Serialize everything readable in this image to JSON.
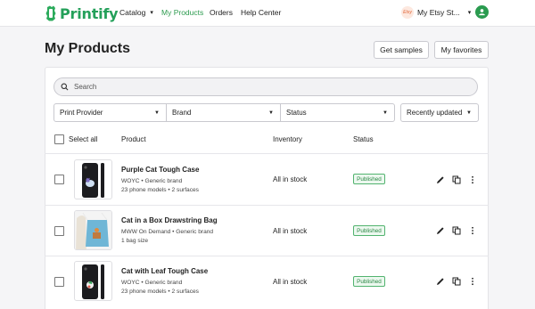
{
  "nav": {
    "logo_text": "Printify",
    "items": [
      {
        "label": "Catalog",
        "has_dropdown": true,
        "active": false
      },
      {
        "label": "My Products",
        "active": true
      },
      {
        "label": "Orders",
        "active": false
      },
      {
        "label": "Help Center",
        "active": false
      }
    ],
    "store": {
      "badge": "Etsy",
      "name": "My Etsy St..."
    },
    "accent_color": "#2a9b4f"
  },
  "page": {
    "title": "My Products",
    "buttons": {
      "samples": "Get samples",
      "favorites": "My favorites"
    }
  },
  "search": {
    "placeholder": "Search",
    "value": ""
  },
  "filters": {
    "print_provider": "Print Provider",
    "brand": "Brand",
    "status": "Status",
    "sort": "Recently updated"
  },
  "table": {
    "select_all": "Select all",
    "columns": {
      "product": "Product",
      "inventory": "Inventory",
      "status": "Status"
    },
    "rows": [
      {
        "name": "Purple Cat Tough Case",
        "meta1": "WOYC • Generic brand",
        "meta2": "23 phone models • 2 surfaces",
        "inventory": "All in stock",
        "status": "Published",
        "thumb": "phone-case-icon"
      },
      {
        "name": "Cat in a Box Drawstring Bag",
        "meta1": "MWW On Demand • Generic brand",
        "meta2": "1 bag size",
        "inventory": "All in stock",
        "status": "Published",
        "thumb": "drawstring-bag-icon"
      },
      {
        "name": "Cat with Leaf Tough Case",
        "meta1": "WOYC • Generic brand",
        "meta2": "23 phone models • 2 surfaces",
        "inventory": "All in stock",
        "status": "Published",
        "thumb": "phone-case-icon"
      }
    ]
  }
}
